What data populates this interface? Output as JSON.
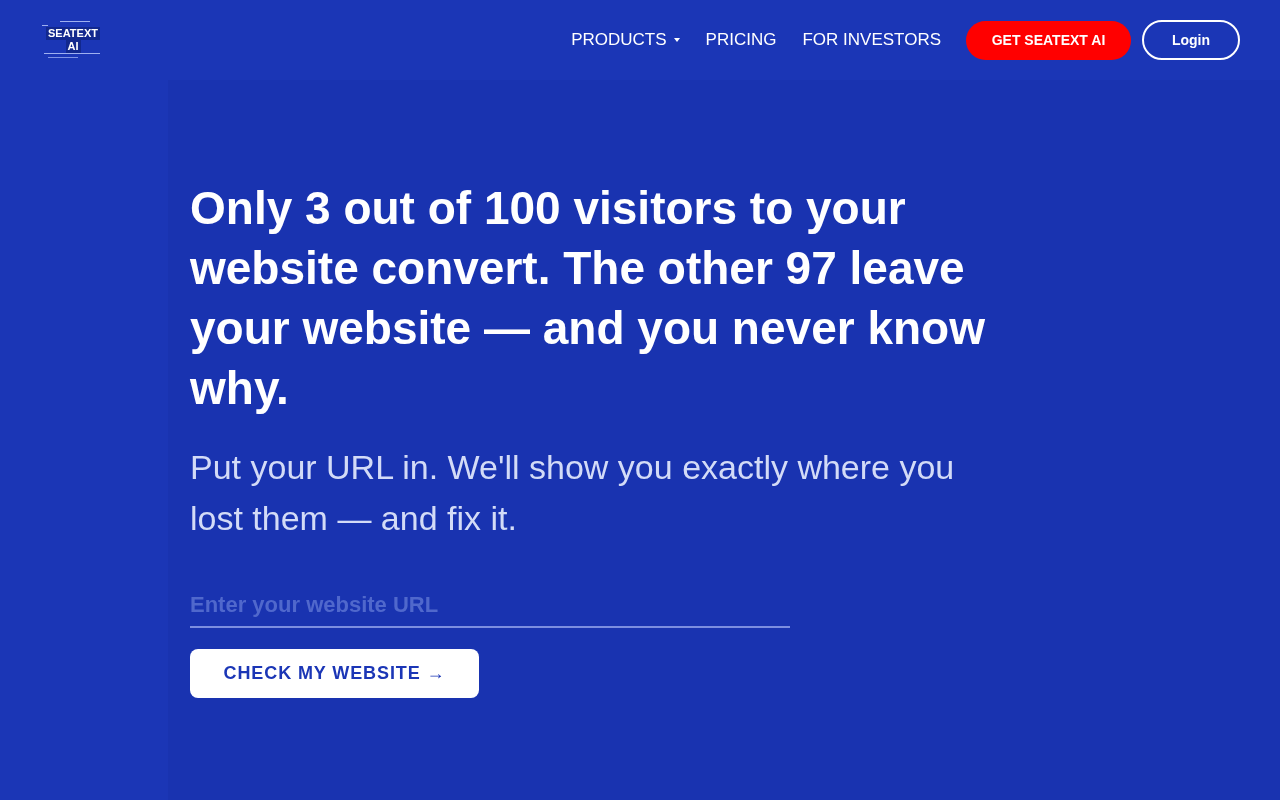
{
  "logo": {
    "lines": [
      "SEATEXT",
      "AI"
    ]
  },
  "nav": {
    "items": [
      {
        "label": "PRODUCTS",
        "has_dropdown": true
      },
      {
        "label": "PRICING",
        "has_dropdown": false
      },
      {
        "label": "FOR INVESTORS",
        "has_dropdown": false
      }
    ],
    "cta_button": "GET SEATEXT AI",
    "login_button": "Login"
  },
  "hero": {
    "headline": "Only 3 out of 100 visitors to your website convert. The other 97 leave your website — and you never know why.",
    "subheadline": "Put your URL in. We'll show you exactly where you lost them — and fix it.",
    "url_field": {
      "placeholder": "Enter your website URL"
    },
    "submit_button": "CHECK MY WEBSITE →"
  }
}
